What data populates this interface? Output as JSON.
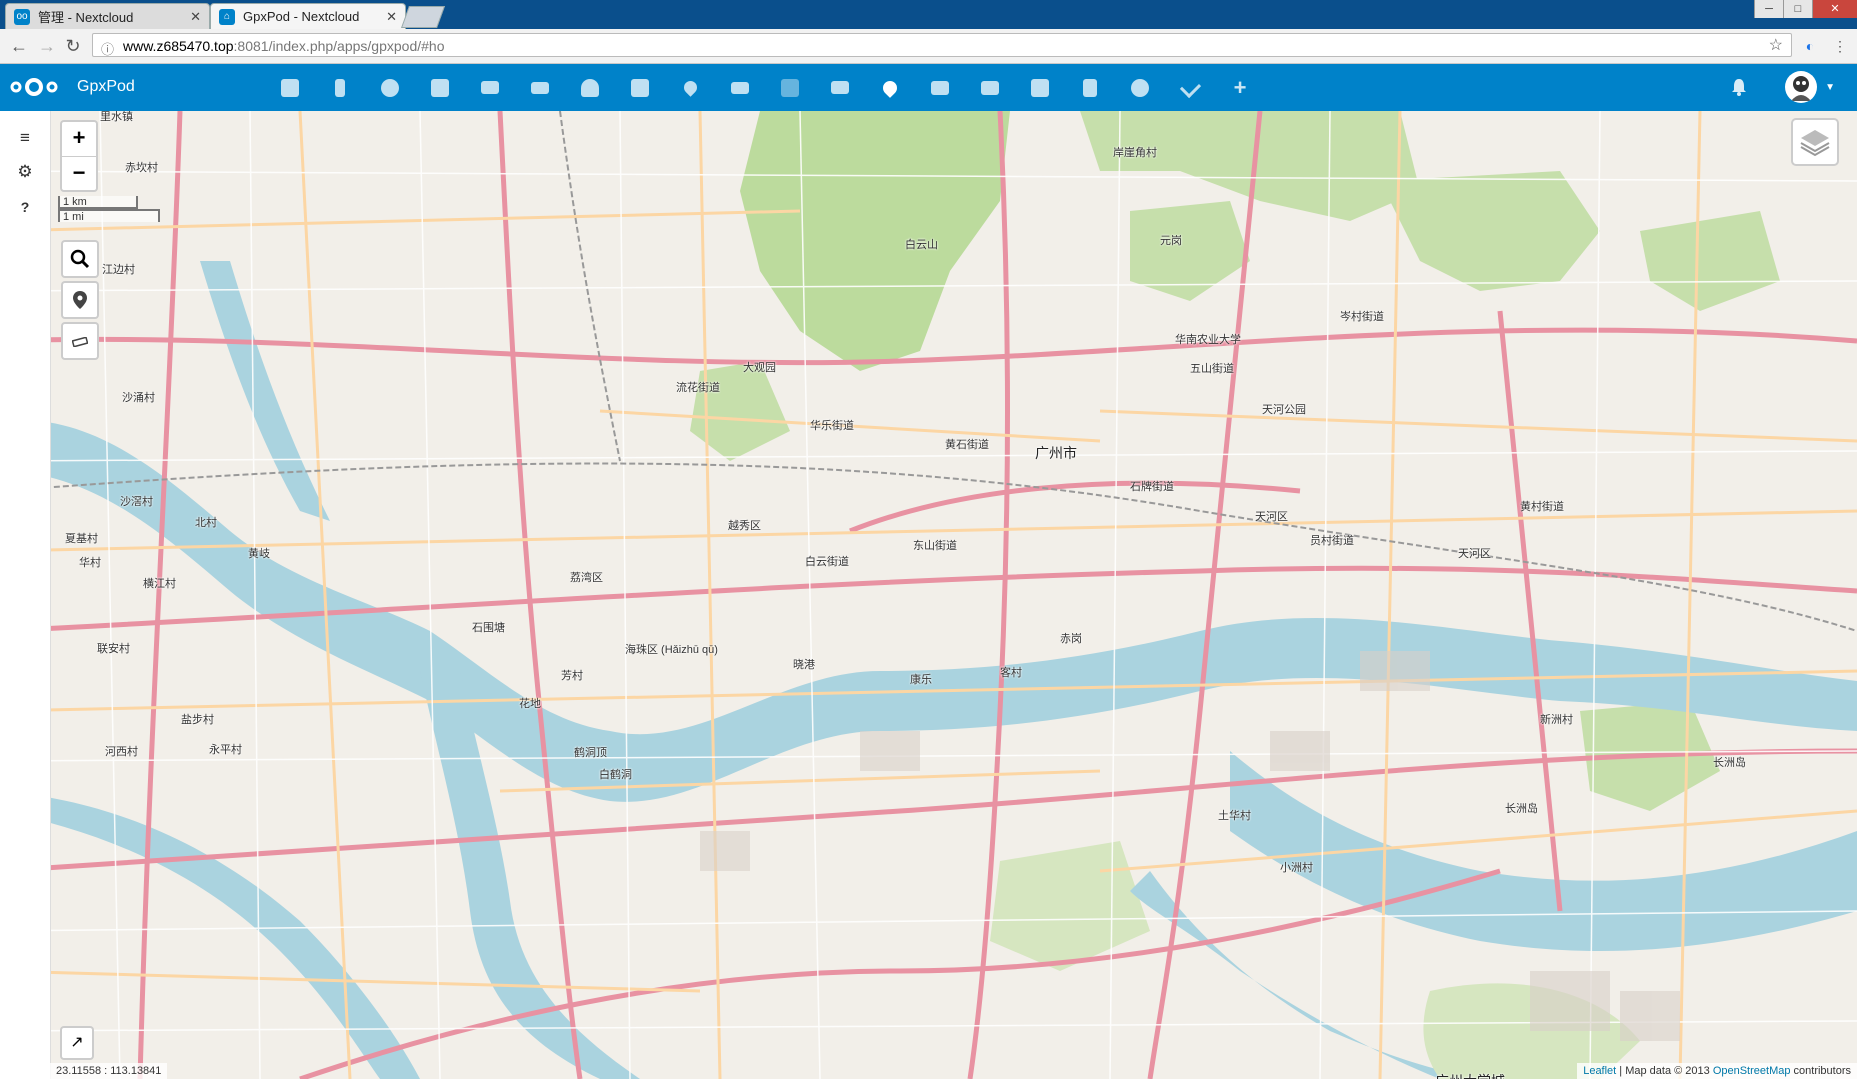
{
  "browser": {
    "tabs": [
      {
        "title": "管理 - Nextcloud",
        "active": false
      },
      {
        "title": "GpxPod - Nextcloud",
        "active": true
      }
    ],
    "url_host": "www.z685470.top",
    "url_rest": ":8081/index.php/apps/gpxpod/#ho",
    "window_controls": [
      "─",
      "□",
      "✕"
    ]
  },
  "header": {
    "app_name": "GpxPod",
    "app_icons": [
      "folder-icon",
      "activity-icon",
      "gallery-icon",
      "pictures-icon",
      "mail-icon",
      "video-icon",
      "contacts-icon",
      "calendar-icon",
      "maps-icon",
      "announcement-icon",
      "bookmarks-icon",
      "news-icon",
      "gpxpod-icon",
      "deck-icon",
      "tables-icon",
      "notes-icon",
      "audio-icon",
      "github-icon",
      "tasks-icon",
      "add-icon"
    ],
    "brand_color": "#0082c9"
  },
  "sidebar": {
    "menu_icon": "≡",
    "settings_icon": "⚙",
    "help_icon": "?"
  },
  "map": {
    "zoom_in": "+",
    "zoom_out": "−",
    "scale_km": "1 km",
    "scale_mi": "1 mi",
    "search_icon": "🔍",
    "marker_icon": "⚲",
    "measure_icon": "▭",
    "expand_icon": "↗",
    "coordinates": "23.11558 : 113.13841",
    "attribution": {
      "leaflet": "Leaflet",
      "middle": " | Map data © 2013 ",
      "osm": "OpenStreetMap",
      "tail": " contributors"
    },
    "labels": {
      "city": "广州市",
      "baiyunshan": "白云山",
      "lishui": "里水镇",
      "chikan": "赤坎村",
      "jiangbian": "江边村",
      "shayong": "沙涌村",
      "shaxi": "沙滘村",
      "beicun": "北村",
      "huangqi": "黄岐",
      "hengjiang": "横江村",
      "shiwei": "石围塘",
      "liwan": "荔湾区",
      "haizhu": "海珠区 (Hǎizhū qū)",
      "baiyun": "白云街道",
      "yuexiu": "越秀区",
      "dongshan": "东山街道",
      "huangshi": "黄石街道",
      "liuhua": "流花街道",
      "huahua": "华乐街道",
      "tianhe": "天河区",
      "tianhe2": "天河区",
      "shipai": "石牌街道",
      "yuancun": "员村街道",
      "huangpu": "黄村街道",
      "chigang": "赤岗",
      "kecun": "客村",
      "kangle": "康乐",
      "xiaogang": "晓港",
      "fangcun": "芳村",
      "huadi": "花地",
      "baihe": "白鹤洞",
      "hedong": "鹤洞顶",
      "changzhou": "长洲岛",
      "xinzhou": "新洲村",
      "changzhou2": "长洲岛",
      "xiaozhou": "小洲村",
      "tuhua": "土华村",
      "cenjiao": "岑村街道",
      "huashan": "华南农业大学",
      "wushan": "五山街道",
      "daxuecheng": "广州大学城",
      "yongping": "永平村",
      "hexi": "河西村",
      "yanbu": "盐步村",
      "huacun": "华村",
      "xiaji": "夏基村",
      "lian": "联安村",
      "tangxia": "岸崖角村",
      "yuangang": "元岗",
      "liuhua_lake": "大观园",
      "tianhe_park": "天河公园"
    }
  }
}
